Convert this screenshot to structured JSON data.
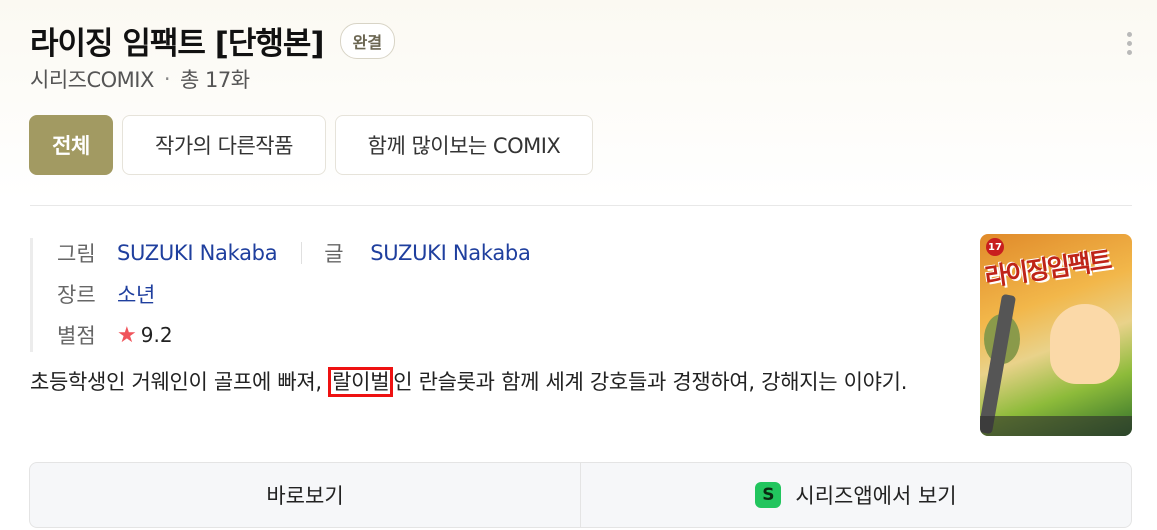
{
  "header": {
    "title": "라이징 임팩트 [단행본]",
    "status_badge": "완결",
    "publisher": "시리즈COMIX",
    "separator": "·",
    "episodes": "총 17화"
  },
  "tabs": [
    {
      "label": "전체",
      "active": true
    },
    {
      "label": "작가의 다른작품",
      "active": false
    },
    {
      "label": "함께 많이보는 COMIX",
      "active": false
    }
  ],
  "meta": {
    "illust_label": "그림",
    "illust_value": "SUZUKI Nakaba",
    "writer_label": "글",
    "writer_value": "SUZUKI Nakaba",
    "genre_label": "장르",
    "genre_value": "소년",
    "rating_label": "별점",
    "rating_star": "★",
    "rating_value": "9.2"
  },
  "description": {
    "before": "초등학생인 거웨인이 골프에 빠져, ",
    "highlight": "랄이벌",
    "after": "인 란슬롯과 함께 세계 강호들과 경쟁하여, 강해지는 이야기."
  },
  "cover": {
    "title_text": "라이징임팩트",
    "corner_mark": "17"
  },
  "actions": {
    "read_now": "바로보기",
    "app_icon_letter": "S",
    "open_in_app": "시리즈앱에서 보기"
  },
  "colors": {
    "accent": "#a29a62",
    "link": "#1f3f9e",
    "star": "#f0545b",
    "highlight_box": "#ee1111",
    "app_icon": "#22c55e"
  }
}
